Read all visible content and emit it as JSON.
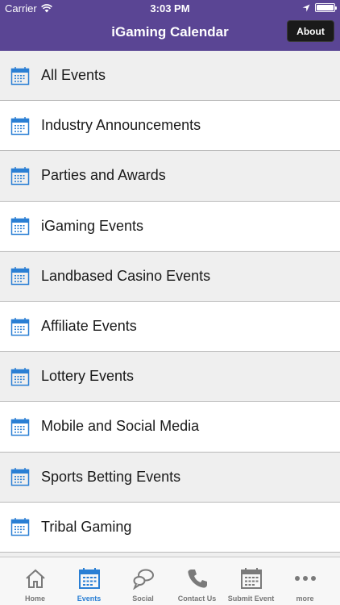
{
  "status_bar": {
    "carrier": "Carrier",
    "time": "3:03 PM"
  },
  "nav": {
    "title": "iGaming Calendar",
    "about_label": "About"
  },
  "colors": {
    "header_bg": "#5a4594",
    "accent_blue": "#2a7fd4",
    "row_shaded": "#efefef",
    "row_white": "#ffffff"
  },
  "list": {
    "items": [
      {
        "label": "All Events",
        "icon": "calendar-icon"
      },
      {
        "label": "Industry Announcements",
        "icon": "calendar-icon"
      },
      {
        "label": "Parties and Awards",
        "icon": "calendar-icon"
      },
      {
        "label": "iGaming Events",
        "icon": "calendar-icon"
      },
      {
        "label": "Landbased Casino Events",
        "icon": "calendar-icon"
      },
      {
        "label": "Affiliate Events",
        "icon": "calendar-icon"
      },
      {
        "label": "Lottery Events",
        "icon": "calendar-icon"
      },
      {
        "label": "Mobile and Social Media",
        "icon": "calendar-icon"
      },
      {
        "label": "Sports Betting Events",
        "icon": "calendar-icon"
      },
      {
        "label": "Tribal Gaming",
        "icon": "calendar-icon"
      }
    ]
  },
  "tab_bar": {
    "tabs": [
      {
        "label": "Home",
        "icon": "home-icon",
        "active": false
      },
      {
        "label": "Events",
        "icon": "calendar-icon",
        "active": true
      },
      {
        "label": "Social",
        "icon": "chat-bubbles-icon",
        "active": false
      },
      {
        "label": "Contact Us",
        "icon": "phone-icon",
        "active": false
      },
      {
        "label": "Submit Event",
        "icon": "calendar-icon",
        "active": false
      },
      {
        "label": "more",
        "icon": "more-dots-icon",
        "active": false
      }
    ]
  }
}
